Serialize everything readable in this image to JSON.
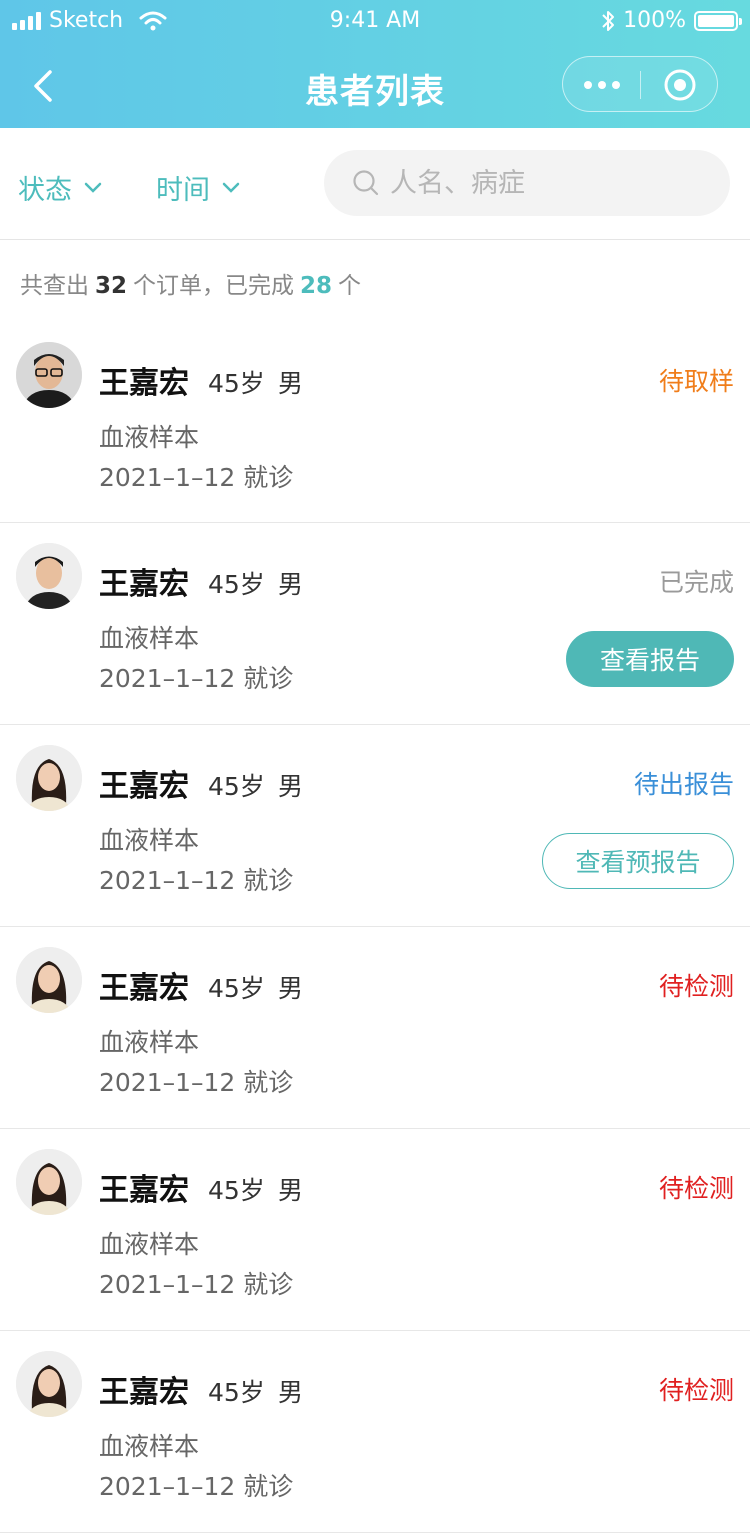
{
  "status_bar": {
    "carrier": "Sketch",
    "time": "9:41 AM",
    "battery": "100%"
  },
  "nav": {
    "title": "患者列表"
  },
  "filters": {
    "status_label": "状态",
    "time_label": "时间",
    "search_placeholder": "人名、病症",
    "search_value": ""
  },
  "summary": {
    "prefix": "共查出",
    "total": "32",
    "middle": "个订单，已完成",
    "completed": "28",
    "suffix": "个"
  },
  "colors": {
    "accent": "#4fb8b6",
    "status_pending_sample": "#f07d1a",
    "status_completed": "#9a9a9a",
    "status_pending_report": "#3a8fd8",
    "status_pending_test": "#e02020"
  },
  "patients": [
    {
      "name": "王嘉宏",
      "age": "45岁",
      "gender": "男",
      "sample": "血液样本",
      "date": "2021–1–12 就诊",
      "status": "待取样",
      "status_color": "#f07d1a",
      "action": "",
      "avatar": "male-portrait-glasses"
    },
    {
      "name": "王嘉宏",
      "age": "45岁",
      "gender": "男",
      "sample": "血液样本",
      "date": "2021–1–12 就诊",
      "status": "已完成",
      "status_color": "#9a9a9a",
      "action": "查看报告",
      "avatar": "male-portrait"
    },
    {
      "name": "王嘉宏",
      "age": "45岁",
      "gender": "男",
      "sample": "血液样本",
      "date": "2021–1–12 就诊",
      "status": "待出报告",
      "status_color": "#3a8fd8",
      "action": "查看预报告",
      "avatar": "female-portrait"
    },
    {
      "name": "王嘉宏",
      "age": "45岁",
      "gender": "男",
      "sample": "血液样本",
      "date": "2021–1–12 就诊",
      "status": "待检测",
      "status_color": "#e02020",
      "action": "",
      "avatar": "female-portrait"
    },
    {
      "name": "王嘉宏",
      "age": "45岁",
      "gender": "男",
      "sample": "血液样本",
      "date": "2021–1–12 就诊",
      "status": "待检测",
      "status_color": "#e02020",
      "action": "",
      "avatar": "female-portrait"
    },
    {
      "name": "王嘉宏",
      "age": "45岁",
      "gender": "男",
      "sample": "血液样本",
      "date": "2021–1–12 就诊",
      "status": "待检测",
      "status_color": "#e02020",
      "action": "",
      "avatar": "female-portrait"
    }
  ]
}
